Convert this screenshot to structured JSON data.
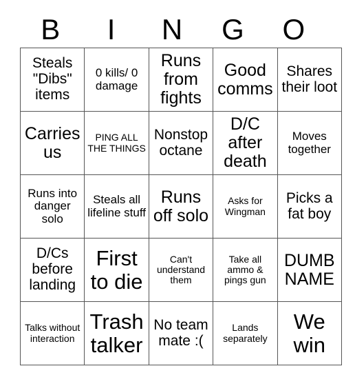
{
  "header": {
    "letters": [
      "B",
      "I",
      "N",
      "G",
      "O"
    ]
  },
  "grid": {
    "rows": [
      [
        {
          "text": "Steals \"Dibs\" items",
          "size": "fs-md"
        },
        {
          "text": "0 kills/ 0 damage",
          "size": "fs-sm"
        },
        {
          "text": "Runs from fights",
          "size": "fs-lg"
        },
        {
          "text": "Good comms",
          "size": "fs-lg"
        },
        {
          "text": "Shares their loot",
          "size": "fs-md"
        }
      ],
      [
        {
          "text": "Carries us",
          "size": "fs-lg"
        },
        {
          "text": "PING ALL THE THINGS",
          "size": "fs-xs"
        },
        {
          "text": "Nonstop octane",
          "size": "fs-md"
        },
        {
          "text": "D/C after death",
          "size": "fs-lg"
        },
        {
          "text": "Moves together",
          "size": "fs-sm"
        }
      ],
      [
        {
          "text": "Runs into danger solo",
          "size": "fs-sm"
        },
        {
          "text": "Steals all lifeline stuff",
          "size": "fs-sm"
        },
        {
          "text": "Runs off solo",
          "size": "fs-lg"
        },
        {
          "text": "Asks for Wingman",
          "size": "fs-xs"
        },
        {
          "text": "Picks a fat boy",
          "size": "fs-md"
        }
      ],
      [
        {
          "text": "D/Cs before landing",
          "size": "fs-md"
        },
        {
          "text": "First to die",
          "size": "fs-xl"
        },
        {
          "text": "Can't understand them",
          "size": "fs-xs"
        },
        {
          "text": "Take all ammo & pings gun",
          "size": "fs-xs"
        },
        {
          "text": "DUMB NAME",
          "size": "fs-lg"
        }
      ],
      [
        {
          "text": "Talks without interaction",
          "size": "fs-xs"
        },
        {
          "text": "Trash talker",
          "size": "fs-xl"
        },
        {
          "text": "No team mate :(",
          "size": "fs-md"
        },
        {
          "text": "Lands separately",
          "size": "fs-xs"
        },
        {
          "text": "We win",
          "size": "fs-xl"
        }
      ]
    ]
  },
  "colors": {
    "background": "#ffffff",
    "text": "#000000",
    "border": "#555555"
  }
}
